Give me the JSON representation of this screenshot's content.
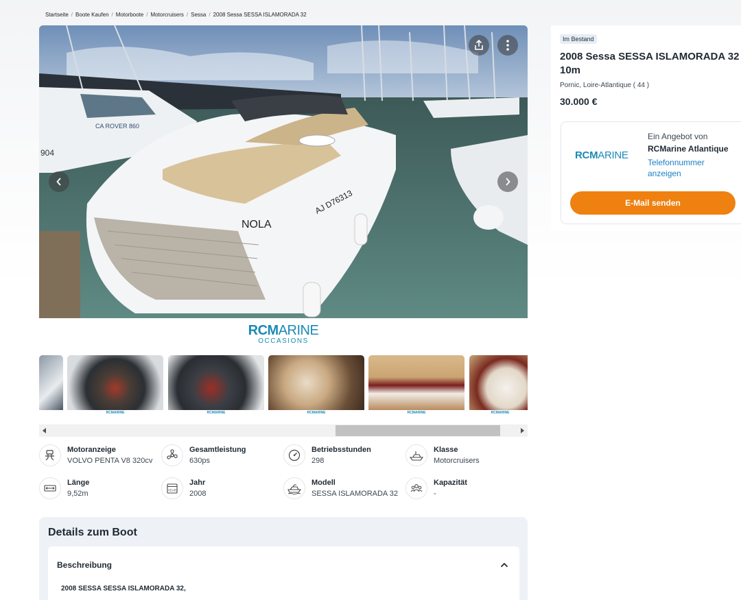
{
  "breadcrumb": [
    "Startseite",
    "Boote Kaufen",
    "Motorboote",
    "Motorcruisers",
    "Sessa",
    "2008 Sessa SESSA ISLAMORADA 32"
  ],
  "hero": {
    "hull_text": "NOLA",
    "registration": "AJ D76313",
    "left_boat_text": "CA ROVER 860",
    "left_boat_number": "904"
  },
  "brand_logo": {
    "main_bold": "RCM",
    "main_thin": "ARINE",
    "sub": "OCCASIONS"
  },
  "thumbnail_label": "RCMARINE",
  "specs": [
    {
      "label": "Motoranzeige",
      "value": "VOLVO PENTA V8 320cv",
      "icon": "engine-icon"
    },
    {
      "label": "Gesamtleistung",
      "value": "630ps",
      "icon": "propeller-icon"
    },
    {
      "label": "Betriebsstunden",
      "value": "298",
      "icon": "gauge-icon"
    },
    {
      "label": "Klasse",
      "value": "Motorcruisers",
      "icon": "boat-class-icon"
    },
    {
      "label": "Länge",
      "value": "9,52m",
      "icon": "length-icon"
    },
    {
      "label": "Jahr",
      "value": "2008",
      "icon": "calendar-icon",
      "icon_text": "YEAR"
    },
    {
      "label": "Modell",
      "value": "SESSA ISLAMORADA 32",
      "icon": "yacht-icon"
    },
    {
      "label": "Kapazität",
      "value": "-",
      "icon": "people-icon"
    }
  ],
  "details": {
    "title": "Details zum Boot",
    "section_title": "Beschreibung",
    "description": "2008 SESSA SESSA ISLAMORADA 32,"
  },
  "listing": {
    "badge": "Im Bestand",
    "title": "2008 Sessa SESSA ISLAMORADA 32 | 10m",
    "location": "Pornic, Loire-Atlantique ( 44 )",
    "price": "30.000 €"
  },
  "seller": {
    "offer_by": "Ein Angebot von",
    "name": "RCMarine Atlantique",
    "phone_link": "Telefonnummer anzeigen",
    "email_button": "E-Mail senden",
    "logo_bold": "RCM",
    "logo_thin": "ARINE"
  },
  "colors": {
    "accent": "#ee8110",
    "brand": "#1a8ab6",
    "link": "#1a7fc2"
  }
}
